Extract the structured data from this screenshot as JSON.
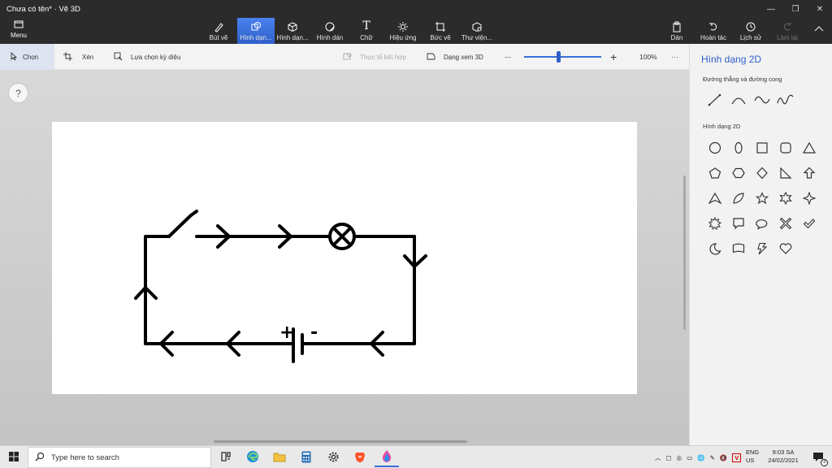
{
  "window": {
    "title": "Chưa có tên* · Vẽ 3D",
    "controls": [
      "—",
      "❐",
      "✕"
    ]
  },
  "ribbon": {
    "menu_label": "Menu",
    "tools": [
      {
        "label": "Bút vẽ",
        "icon": "brush-icon"
      },
      {
        "label": "Hình dạn...",
        "icon": "2d-shapes-icon",
        "active": true
      },
      {
        "label": "Hình dạn...",
        "icon": "3d-shapes-icon"
      },
      {
        "label": "Hình dán",
        "icon": "sticker-icon"
      },
      {
        "label": "Chữ",
        "icon": "text-icon"
      },
      {
        "label": "Hiệu ứng",
        "icon": "effects-icon"
      },
      {
        "label": "Bức vẽ",
        "icon": "canvas-icon"
      },
      {
        "label": "Thư viện...",
        "icon": "library-icon"
      }
    ],
    "right_tools": [
      {
        "label": "Dán",
        "icon": "paste-icon"
      },
      {
        "label": "Hoàn tác",
        "icon": "undo-icon"
      },
      {
        "label": "Lịch sử",
        "icon": "history-icon"
      },
      {
        "label": "Làm lại",
        "icon": "redo-icon",
        "disabled": true
      }
    ]
  },
  "subbar": {
    "select_label": "Chọn",
    "crop_label": "Xén",
    "magic_select_label": "Lựa chọn kỳ diệu",
    "mixed_reality_label": "Thực tế kết hợp",
    "view3d_label": "Dạng xem 3D",
    "zoom_minus": "—",
    "zoom_plus": "+",
    "zoom_level": "100%",
    "zoom_fraction": 0.45,
    "more": "···"
  },
  "workspace": {
    "help_label": "?"
  },
  "panel": {
    "title": "Hình dạng 2D",
    "lines_section": "Đường thẳng và đường cong",
    "shapes_section": "Hình dạng 2D",
    "line_shapes": [
      "line-icon",
      "curve-icon",
      "s-curve-icon",
      "wave-curve-icon"
    ],
    "shapes_2d": [
      "circle-icon",
      "ellipse-icon",
      "square-icon",
      "rounded-square-icon",
      "triangle-icon",
      "pentagon-icon",
      "hexagon-icon",
      "diamond-icon",
      "right-triangle-icon",
      "arrow-up-icon",
      "arrowhead-icon",
      "leaf-icon",
      "star-5-icon",
      "star-6-icon",
      "star-4-icon",
      "burst-icon",
      "speech-bubble-rect-icon",
      "speech-bubble-oval-icon",
      "x-mark-icon",
      "checkmark-icon",
      "moon-icon",
      "banner-icon",
      "lightning-icon",
      "heart-icon"
    ]
  },
  "circuit": {
    "positive_label": "+",
    "negative_label": "-"
  },
  "taskbar": {
    "search_placeholder": "Type here to search",
    "lang_top": "ENG",
    "lang_bottom": "US",
    "time": "9:03 SA",
    "date": "24/02/2021",
    "notification_count": "3"
  },
  "colors": {
    "accent": "#3a6fd8",
    "titlebar": "#2b2b2b",
    "panel_title": "#2f5fc8"
  }
}
